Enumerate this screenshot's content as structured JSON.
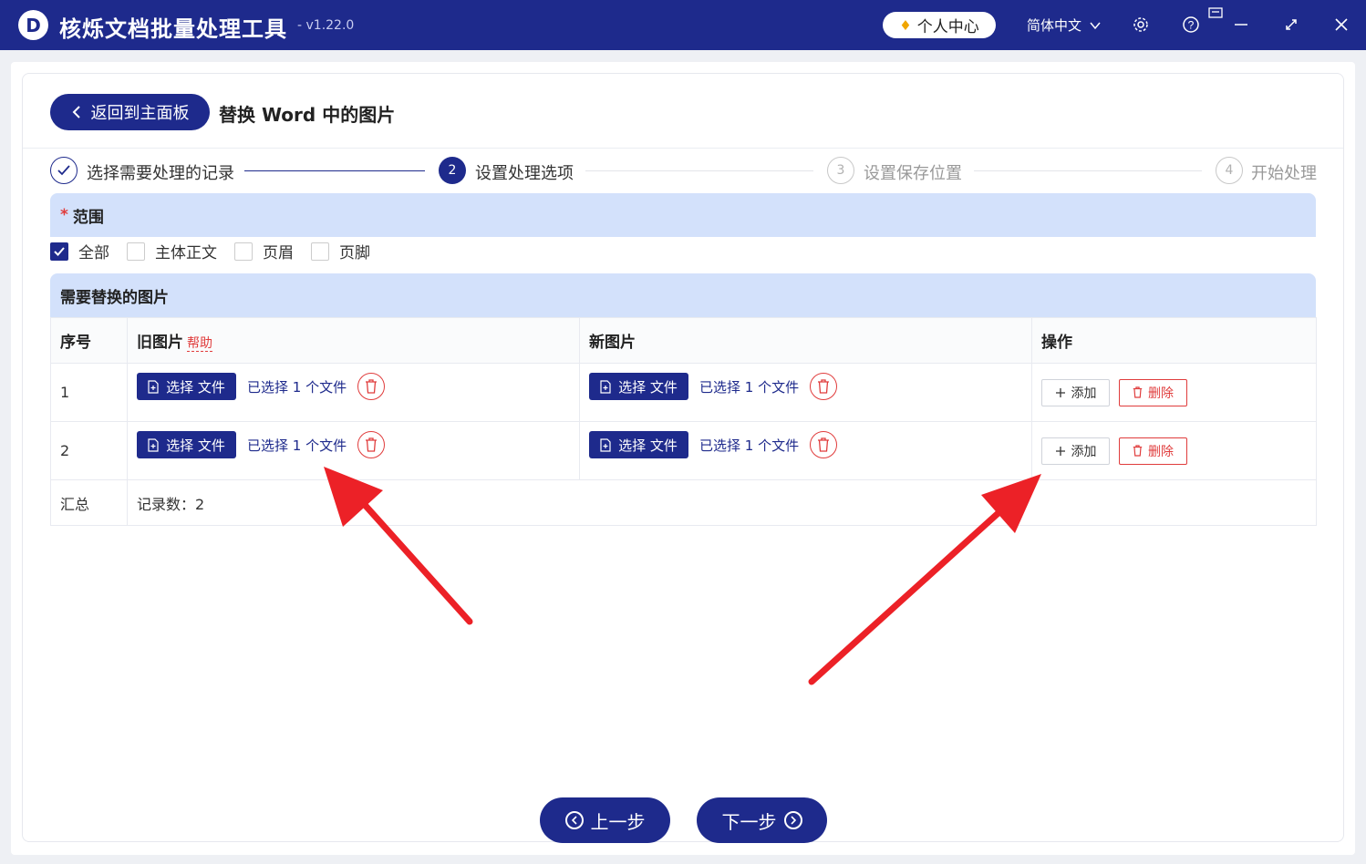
{
  "app": {
    "logo_letter": "D",
    "title": "核烁文档批量处理工具",
    "version": "- v1.22.0",
    "user_center": "个人中心",
    "language": "简体中文"
  },
  "header": {
    "back_label": "返回到主面板",
    "page_title": "替换 Word 中的图片"
  },
  "steps": [
    {
      "number": "1",
      "label": "选择需要处理的记录",
      "state": "done"
    },
    {
      "number": "2",
      "label": "设置处理选项",
      "state": "active"
    },
    {
      "number": "3",
      "label": "设置保存位置",
      "state": "todo"
    },
    {
      "number": "4",
      "label": "开始处理",
      "state": "todo"
    }
  ],
  "scope": {
    "title": "范围",
    "required_mark": "*",
    "options": [
      {
        "label": "全部",
        "checked": true
      },
      {
        "label": "主体正文",
        "checked": false
      },
      {
        "label": "页眉",
        "checked": false
      },
      {
        "label": "页脚",
        "checked": false
      }
    ]
  },
  "images_section": {
    "title": "需要替换的图片",
    "columns": {
      "index": "序号",
      "old": "旧图片",
      "help": "帮助",
      "new": "新图片",
      "actions": "操作"
    },
    "rows": [
      {
        "index": "1",
        "old_button": "选择 文件",
        "old_status": "已选择 1 个文件",
        "new_button": "选择 文件",
        "new_status": "已选择 1 个文件",
        "add": "添加",
        "delete": "删除"
      },
      {
        "index": "2",
        "old_button": "选择 文件",
        "old_status": "已选择 1 个文件",
        "new_button": "选择 文件",
        "new_status": "已选择 1 个文件",
        "add": "添加",
        "delete": "删除"
      }
    ],
    "summary": {
      "label": "汇总",
      "value": "记录数：2"
    }
  },
  "nav": {
    "prev": "上一步",
    "next": "下一步"
  },
  "colors": {
    "brand": "#1e2a8c",
    "section_bg": "#d3e1fb",
    "danger": "#e03c3c",
    "annotation_arrow": "#ec2127"
  }
}
